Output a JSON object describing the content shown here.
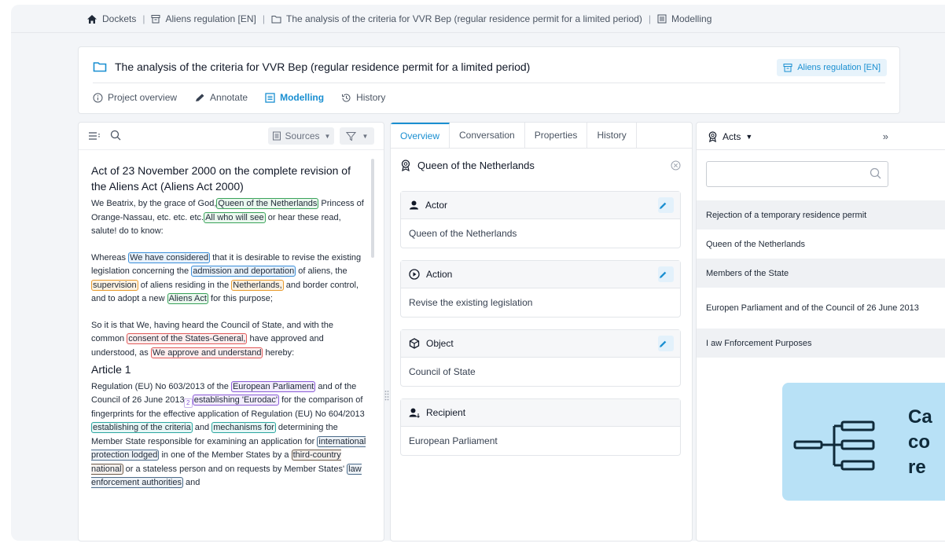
{
  "breadcrumb": {
    "items": [
      "Dockets",
      "Aliens regulation [EN]",
      "The analysis of the criteria for VVR Bep (regular residence permit for a limited period)",
      "Modelling"
    ]
  },
  "header": {
    "title": "The analysis of the criteria for VVR Bep (regular residence permit for a limited period)",
    "badge": "Aliens regulation [EN]",
    "tabs": [
      "Project overview",
      "Annotate",
      "Modelling",
      "History"
    ],
    "active_tab": "Modelling"
  },
  "left_panel": {
    "sources_label": "Sources",
    "doc_title": "Act of 23 November 2000 on the complete revision of the Aliens Act (Aliens Act 2000)",
    "p1": {
      "a": "We Beatrix, by the grace of God,",
      "h1": "Queen of the Netherlands",
      "b": " Princess of Orange-Nassau, etc. etc. etc.",
      "h2": "All who will see",
      "c": " or hear these read, salute! do to know:"
    },
    "p2": {
      "a": "Whereas ",
      "h1": "We have considered",
      "b": " that it is desirable to revise the existing legislation concerning the ",
      "h2": "admission and deportation",
      "c": " of aliens, the ",
      "h3": "supervision",
      "d": " of aliens residing in the ",
      "h4": "Netherlands,",
      "e": " and border control, and to adopt a new ",
      "h5": "Aliens Act",
      "f": " for this purpose;"
    },
    "p3": {
      "a": "So it is that We, having heard the Council of State, and with the common ",
      "h1": "consent of the States-General,",
      "b": " have approved and understood, as ",
      "h2": "We approve and understand",
      "c": " hereby:"
    },
    "article": "Article 1",
    "p4": {
      "a": "Regulation (EU) No 603/2013 of the ",
      "h1": "European Parliament",
      "sup": "2",
      "b": " and of the Council of 26 June 2013 ",
      "h2": "establishing 'Eurodac'",
      "c": " for the comparison of fingerprints for the effective application of Regulation (EU) No 604/2013 ",
      "h3": "establishing of the criteria",
      "d": " and ",
      "h4": "mechanisms for",
      "e": " determining the Member State responsible for examining an application for ",
      "h5": "international protection lodged",
      "f": " in one of the Member States by a ",
      "h6": "third-country national",
      "g": " or a stateless person and on requests by Member States' ",
      "h7": "law enforcement authorities",
      "h": " and"
    }
  },
  "middle_panel": {
    "tabs": [
      "Overview",
      "Conversation",
      "Properties",
      "History"
    ],
    "active_tab": "Overview",
    "entity_title": "Queen of the Netherlands",
    "cards": [
      {
        "label": "Actor",
        "value": "Queen of the Netherlands",
        "editable": true
      },
      {
        "label": "Action",
        "value": "Revise the existing legislation",
        "editable": true
      },
      {
        "label": "Object",
        "value": "Council of State",
        "editable": true
      },
      {
        "label": "Recipient",
        "value": "European Parliament",
        "editable": false
      }
    ]
  },
  "right_panel": {
    "title": "Acts",
    "collapse": "»",
    "search_placeholder": "",
    "items": [
      "Rejection of a temporary residence permit",
      "Queen of the Netherlands",
      "Members of the State",
      "Europen Parliament and of the Council of 26 June 2013",
      "I aw Fnforcement Purposes"
    ]
  },
  "promo": {
    "lines": [
      "Ca",
      "co",
      "re"
    ]
  },
  "colors": {
    "accent": "#1a8fd1",
    "promo_bg": "#b8e1f6"
  }
}
